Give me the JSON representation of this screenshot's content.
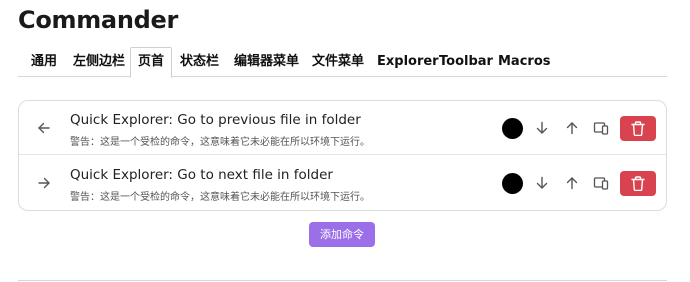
{
  "app": {
    "title": "Commander"
  },
  "tabs": [
    {
      "label": "通用",
      "active": false
    },
    {
      "label": "左侧边栏",
      "active": false
    },
    {
      "label": "页首",
      "active": true
    },
    {
      "label": "状态栏",
      "active": false
    },
    {
      "label": "编辑器菜单",
      "active": false
    },
    {
      "label": "文件菜单",
      "active": false
    },
    {
      "label": "Explorer",
      "active": false
    },
    {
      "label": "Toolbar",
      "active": false
    },
    {
      "label": "Macros",
      "active": false
    }
  ],
  "commands": [
    {
      "icon": "arrow-left-icon",
      "name": "Quick Explorer: Go to previous file in folder",
      "warning": "警告：这是一个受检的命令，这意味着它未必能在所以环境下运行。",
      "color": "#000000"
    },
    {
      "icon": "arrow-right-icon",
      "name": "Quick Explorer: Go to next file in folder",
      "warning": "警告：这是一个受检的命令，这意味着它未必能在所以环境下运行。",
      "color": "#000000"
    }
  ],
  "row_actions": {
    "move_down_icon": "arrow-down-icon",
    "move_up_icon": "arrow-up-icon",
    "device_icon": "devices-icon",
    "delete_icon": "trash-icon",
    "delete_color": "#d9434f"
  },
  "add_button": {
    "label": "添加命令",
    "color": "#9b6fe8"
  }
}
